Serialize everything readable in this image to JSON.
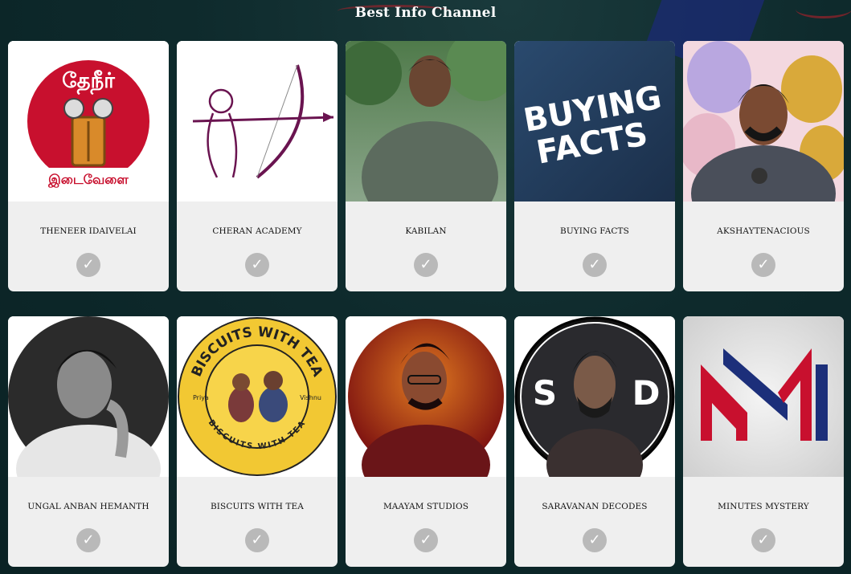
{
  "header": {
    "title": "Best Info Channel"
  },
  "channels": [
    {
      "name": "THENEER IDAIVELAI",
      "logo_text_top": "தேநீர்",
      "logo_text_bottom": "இடைவேளை",
      "logo_icon": "tea-glass-logo-icon"
    },
    {
      "name": "CHERAN ACADEMY",
      "logo_icon": "archer-logo-icon"
    },
    {
      "name": "KABILAN",
      "logo_icon": "person-photo-icon"
    },
    {
      "name": "BUYING FACTS",
      "logo_text_top": "BUYING",
      "logo_text_bottom": "FACTS",
      "logo_icon": "buying-facts-logo-icon"
    },
    {
      "name": "AKSHAYTENACIOUS",
      "logo_icon": "person-with-balloons-icon"
    },
    {
      "name": "UNGAL ANBAN HEMANTH",
      "logo_icon": "bw-portrait-icon"
    },
    {
      "name": "BISCUITS WITH TEA",
      "logo_text_top": "BISCUITS WITH TEA",
      "logo_text_bottom": "BISCUITS WITH TEA",
      "logo_left": "Priya",
      "logo_right": "Vishnu",
      "logo_icon": "biscuits-with-tea-logo-icon"
    },
    {
      "name": "MAAYAM STUDIOS",
      "logo_icon": "red-portrait-icon"
    },
    {
      "name": "SARAVANAN DECODES",
      "logo_text_left": "S",
      "logo_text_right": "D",
      "logo_icon": "sd-portrait-icon"
    },
    {
      "name": "MINUTES MYSTERY",
      "logo_icon": "mm-logo-icon"
    }
  ],
  "check_glyph": "✓",
  "colors": {
    "background": "#0e2a2c",
    "card": "#efefef",
    "check": "#b9b9b9",
    "red": "#c8102e",
    "blue": "#1c2f7a"
  }
}
